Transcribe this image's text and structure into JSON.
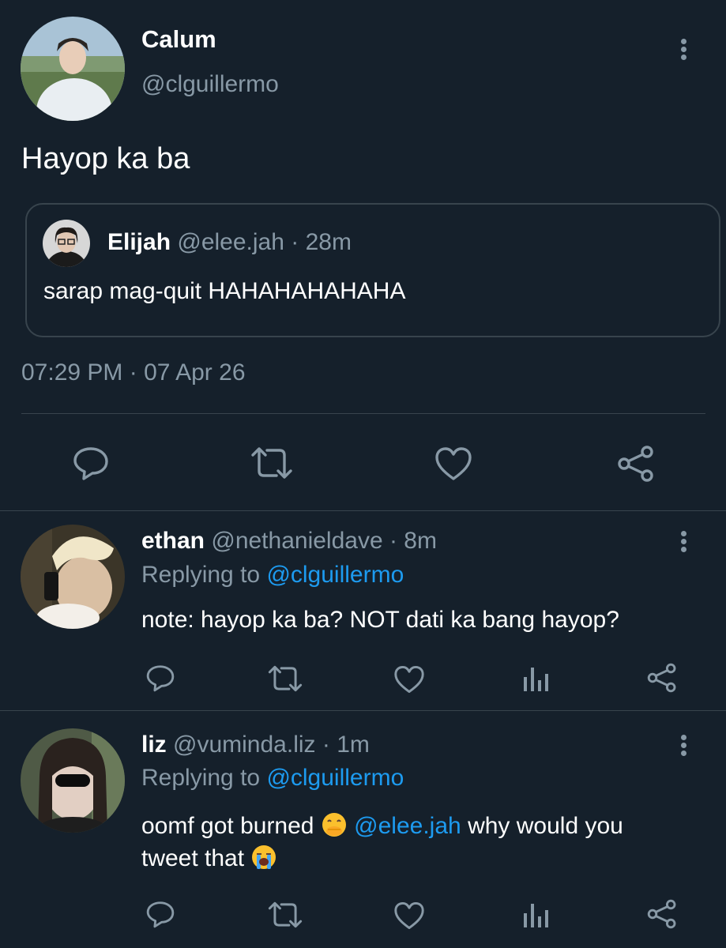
{
  "main_tweet": {
    "display_name": "Calum",
    "handle": "@clguillermo",
    "text": "Hayop ka ba",
    "timestamp": "07:29 PM · 07 Apr 26",
    "quoted": {
      "display_name": "Elijah",
      "handle": "@elee.jah",
      "time_ago": "· 28m",
      "text": "sarap mag-quit HAHAHAHAHAHA"
    }
  },
  "replies": [
    {
      "display_name": "ethan",
      "handle": "@nethanieldave",
      "time_ago": "· 8m",
      "replying_label": "Replying to",
      "replying_handle": "@clguillermo",
      "text": "note: hayop ka ba? NOT dati ka bang hayop?"
    },
    {
      "display_name": "liz",
      "handle": "@vuminda.liz",
      "time_ago": "· 1m",
      "replying_label": "Replying to",
      "replying_handle": "@clguillermo",
      "text_part1": "oomf got burned",
      "mention": "@elee.jah",
      "text_part2": "why would you",
      "text_line2": "tweet that"
    }
  ],
  "colors": {
    "background": "#15202b",
    "muted": "#8899a6",
    "link": "#1d9bf0",
    "divider": "#38444d"
  },
  "icons": [
    "more-vertical-icon",
    "reply-icon",
    "retweet-icon",
    "like-icon",
    "share-icon",
    "analytics-icon",
    "hand-over-mouth-emoji",
    "loudly-crying-emoji"
  ]
}
